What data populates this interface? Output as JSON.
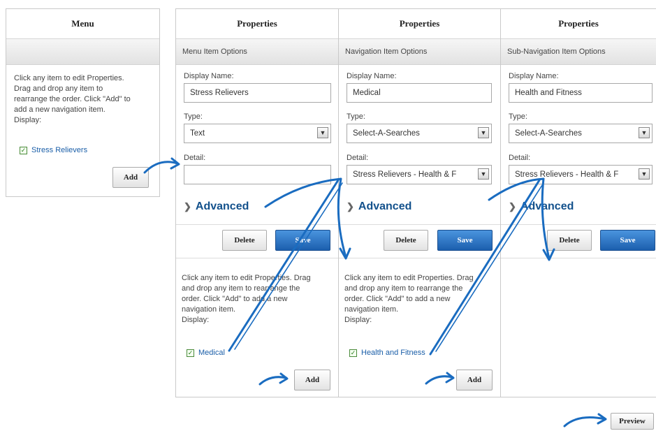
{
  "menu": {
    "header": "Menu",
    "help_lines": [
      "Click any item to edit Properties.",
      "Drag and drop any item to",
      "rearrange the order. Click \"Add\" to",
      "add a new navigation item.",
      "Display:"
    ],
    "item": "Stress Relievers",
    "add_label": "Add"
  },
  "panels": [
    {
      "header": "Properties",
      "subheader": "Menu Item Options",
      "display_name_label": "Display Name:",
      "display_name_value": "Stress Relievers",
      "type_label": "Type:",
      "type_value": "Text",
      "detail_label": "Detail:",
      "detail_value": "",
      "advanced_label": "Advanced",
      "delete_label": "Delete",
      "save_label": "Save",
      "help_lines": [
        "Click any item to edit Properties. Drag",
        "and drop any item to rearrange the",
        "order. Click \"Add\" to add a new",
        "navigation item.",
        "Display:"
      ],
      "item": "Medical",
      "add_label": "Add"
    },
    {
      "header": "Properties",
      "subheader": "Navigation Item Options",
      "display_name_label": "Display Name:",
      "display_name_value": "Medical",
      "type_label": "Type:",
      "type_value": "Select-A-Searches",
      "detail_label": "Detail:",
      "detail_value": "Stress Relievers - Health & F",
      "advanced_label": "Advanced",
      "delete_label": "Delete",
      "save_label": "Save",
      "help_lines": [
        "Click any item to edit Properties. Drag",
        "and drop any item to rearrange the",
        "order. Click \"Add\" to add a new",
        "navigation item.",
        "Display:"
      ],
      "item": "Health and Fitness",
      "add_label": "Add"
    },
    {
      "header": "Properties",
      "subheader": "Sub-Navigation Item Options",
      "display_name_label": "Display Name:",
      "display_name_value": "Health and Fitness",
      "type_label": "Type:",
      "type_value": "Select-A-Searches",
      "detail_label": "Detail:",
      "detail_value": "Stress Relievers - Health & F",
      "advanced_label": "Advanced",
      "delete_label": "Delete",
      "save_label": "Save"
    }
  ],
  "preview_label": "Preview",
  "colors": {
    "accent_blue": "#1f66b8",
    "link_blue": "#1a5ea8",
    "arrow_blue": "#1a6cc0"
  }
}
